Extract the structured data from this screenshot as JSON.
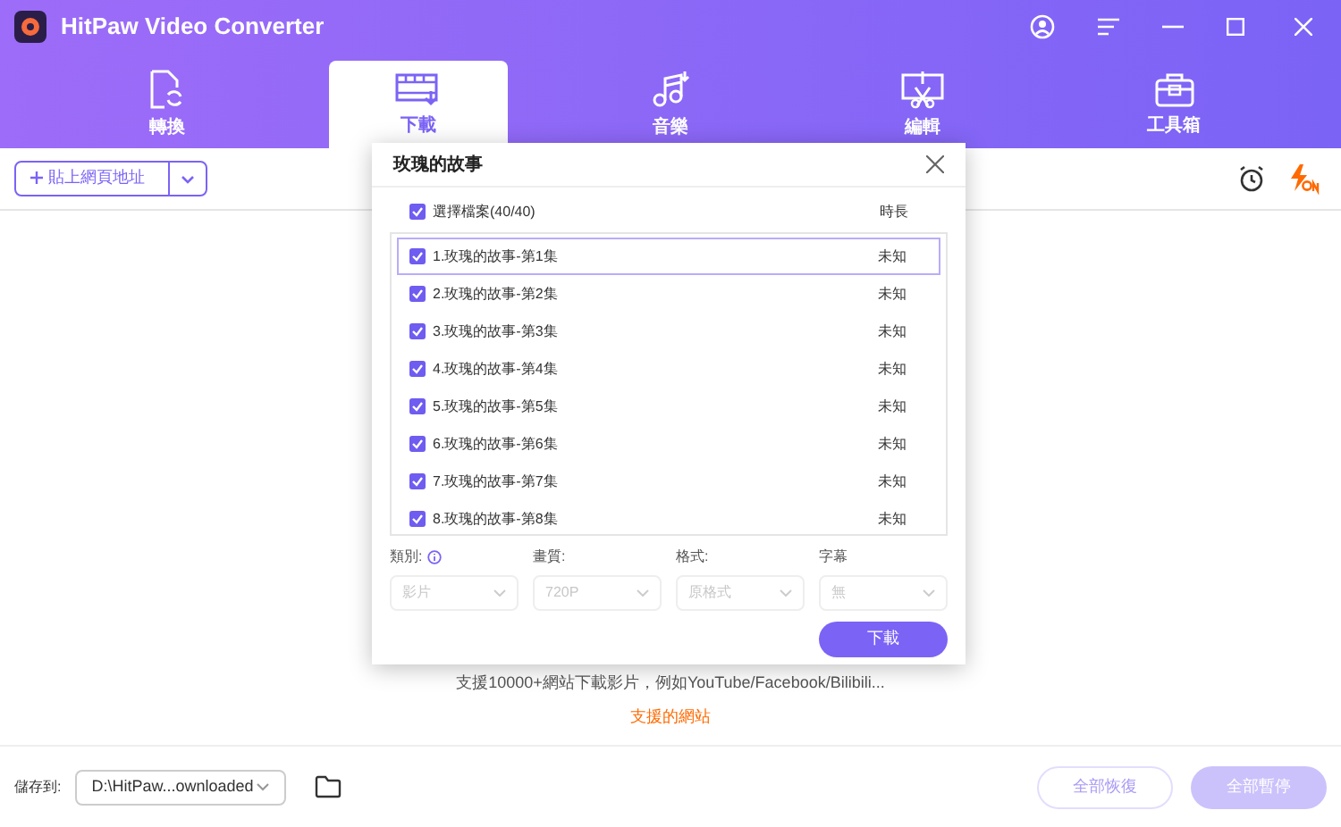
{
  "window": {
    "title": "HitPaw Video Converter"
  },
  "tabs": [
    {
      "label": "轉換",
      "selected": false
    },
    {
      "label": "下載",
      "selected": true
    },
    {
      "label": "音樂",
      "selected": false
    },
    {
      "label": "編輯",
      "selected": false
    },
    {
      "label": "工具箱",
      "selected": false
    }
  ],
  "toolbar": {
    "paste_button": "貼上網頁地址"
  },
  "background": {
    "hint": "支援10000+網站下載影片，例如YouTube/Facebook/Bilibili...",
    "link": "支援的網站"
  },
  "dialog": {
    "title": "玫瑰的故事",
    "select_all": {
      "label": "選擇檔案(40/40)",
      "checked": true
    },
    "duration_header": "時長",
    "items": [
      {
        "name": "1.玫瑰的故事-第1集",
        "duration": "未知",
        "checked": true,
        "selected": true
      },
      {
        "name": "2.玫瑰的故事-第2集",
        "duration": "未知",
        "checked": true,
        "selected": false
      },
      {
        "name": "3.玫瑰的故事-第3集",
        "duration": "未知",
        "checked": true,
        "selected": false
      },
      {
        "name": "4.玫瑰的故事-第4集",
        "duration": "未知",
        "checked": true,
        "selected": false
      },
      {
        "name": "5.玫瑰的故事-第5集",
        "duration": "未知",
        "checked": true,
        "selected": false
      },
      {
        "name": "6.玫瑰的故事-第6集",
        "duration": "未知",
        "checked": true,
        "selected": false
      },
      {
        "name": "7.玫瑰的故事-第7集",
        "duration": "未知",
        "checked": true,
        "selected": false
      },
      {
        "name": "8.玫瑰的故事-第8集",
        "duration": "未知",
        "checked": true,
        "selected": false
      }
    ],
    "options": [
      {
        "label": "類別:",
        "value": "影片",
        "info": true,
        "disabled": true
      },
      {
        "label": "畫質:",
        "value": "720P",
        "info": false,
        "disabled": true
      },
      {
        "label": "格式:",
        "value": "原格式",
        "info": false,
        "disabled": true
      },
      {
        "label": "字幕",
        "value": "無",
        "info": false,
        "disabled": true
      }
    ],
    "download_button": "下載"
  },
  "footer": {
    "save_label": "儲存到:",
    "save_path": "D:\\HitPaw...ownloaded",
    "buttons": [
      {
        "label": "全部恢復",
        "kind": "outline",
        "disabled": true
      },
      {
        "label": "全部暫停",
        "kind": "filled",
        "disabled": true
      }
    ]
  }
}
